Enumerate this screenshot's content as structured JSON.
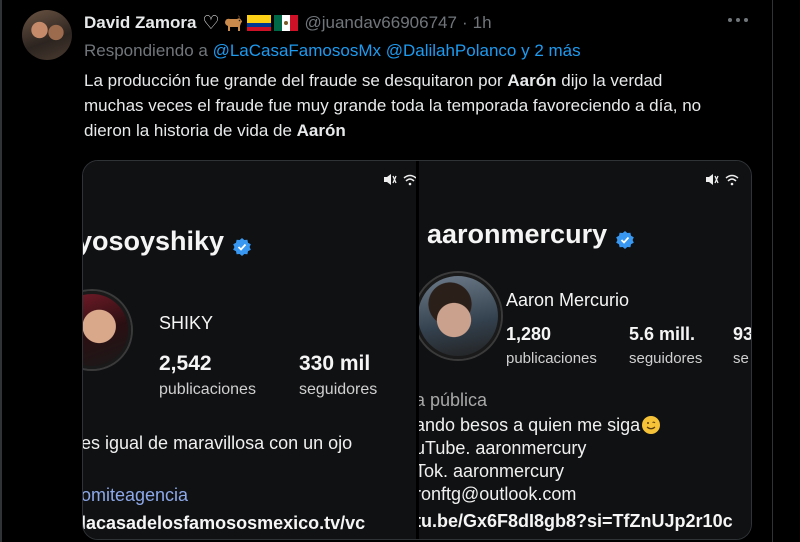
{
  "tweet": {
    "author_name": "David Zamora",
    "author_emojis": [
      "white-heart-icon",
      "dog-icon",
      "colombia-flag-icon",
      "mexico-flag-icon"
    ],
    "handle": "@juandav66906747",
    "separator": "·",
    "time": "1h",
    "reply_prefix": "Respondiendo a",
    "reply_mentions": "@LaCasaFamososMx @DalilahPolanco y 2 más",
    "text_part1": "La producción fue grande del fraude se desquitaron por ",
    "text_bold1": "Aarón",
    "text_part2": " dijo la verdad muchas veces el fraude fue muy grande toda la temporada favoreciendo a día, no dieron la historia de vida de ",
    "text_bold2": "Aarón",
    "colors": {
      "background": "#000000",
      "text": "#e7e9ea",
      "muted": "#71767b",
      "link": "#1d9bf0"
    }
  },
  "media": {
    "left": {
      "username": "yosoyshiky",
      "display_name": "SHIKY",
      "posts_value": "2,542",
      "posts_label": "publicaciones",
      "followers_value": "330 mil",
      "followers_label": "seguidores",
      "bio_line": "es igual de maravillosa con un ojo",
      "bio_link": "omiteagencia",
      "bio_url": "lacasadelosfamososmexico.tv/vc"
    },
    "right": {
      "username": "aaronmercury",
      "display_name": "Aaron Mercurio",
      "posts_value": "1,280",
      "posts_label": "publicaciones",
      "followers_value": "5.6 mill.",
      "followers_label": "seguidores",
      "following_value": "93",
      "following_label": "se",
      "category": "a pública",
      "bio_line1": "ando besos a quien me siga",
      "bio_line2": "uTube. aaronmercury",
      "bio_line3": "Tok. aaronmercury",
      "bio_line4": "ronftg@outlook.com",
      "bio_url": "tu.be/Gx6F8dI8gb8?si=TfZnUJp2r10c"
    }
  }
}
